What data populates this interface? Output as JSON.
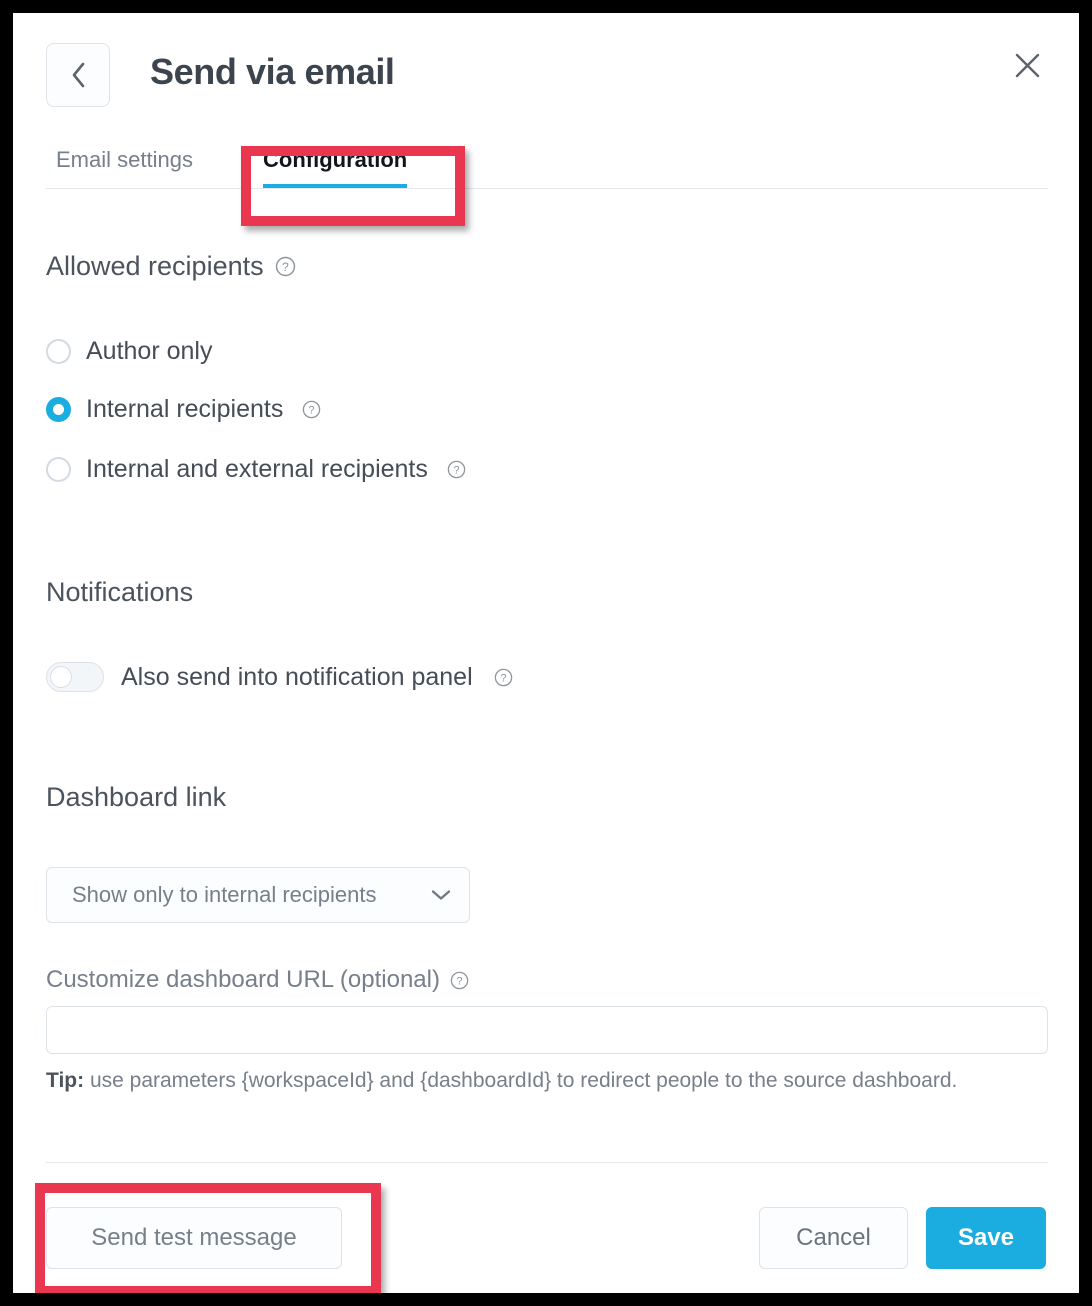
{
  "window": {
    "title": "Send via email",
    "back_icon": "chevron-left-icon",
    "close_icon": "close-icon"
  },
  "tabs": [
    {
      "label": "Email settings",
      "active": false
    },
    {
      "label": "Configuration",
      "active": true
    }
  ],
  "sections": {
    "allowed_recipients": {
      "title": "Allowed recipients",
      "has_help": true,
      "options": [
        {
          "label": "Author only",
          "selected": false,
          "has_help": false
        },
        {
          "label": "Internal recipients",
          "selected": true,
          "has_help": true
        },
        {
          "label": "Internal and external recipients",
          "selected": false,
          "has_help": true
        }
      ]
    },
    "notifications": {
      "title": "Notifications",
      "has_help": false,
      "toggle": {
        "label": "Also send into notification panel",
        "enabled": false,
        "has_help": true
      }
    },
    "dashboard_link": {
      "title": "Dashboard link",
      "has_help": false,
      "select": {
        "value": "Show only to internal recipients",
        "chevron_icon": "chevron-down-icon"
      },
      "url_field": {
        "label": "Customize dashboard URL (optional)",
        "has_help": true,
        "value": "",
        "placeholder": ""
      },
      "tip": {
        "prefix": "Tip:",
        "text": " use parameters {workspaceId} and {dashboardId} to redirect people to the source dashboard."
      }
    }
  },
  "footer": {
    "send_test_label": "Send test message",
    "cancel_label": "Cancel",
    "save_label": "Save"
  },
  "colors": {
    "accent": "#1CADE0",
    "annotation": "#E8374E",
    "text_primary": "#454D57",
    "text_muted": "#767F8A",
    "border": "#DDE3E9"
  },
  "annotations": [
    {
      "target": "Configuration",
      "color": "#E8374E"
    },
    {
      "target": "Send test message",
      "color": "#E8374E"
    }
  ]
}
